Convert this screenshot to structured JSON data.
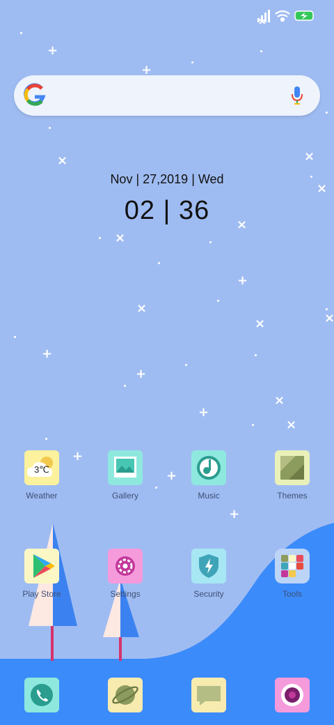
{
  "status_bar": {
    "icons": [
      "signal-icon",
      "wifi-icon",
      "battery-charging-icon"
    ]
  },
  "search": {
    "logo": "G",
    "icon": "microphone-icon"
  },
  "clock": {
    "date": "Nov | 27,2019 | Wed",
    "time": "02 | 36"
  },
  "apps": [
    {
      "label": "Weather",
      "icon": "weather-icon",
      "temp": "3℃"
    },
    {
      "label": "Gallery",
      "icon": "gallery-icon"
    },
    {
      "label": "Music",
      "icon": "music-icon"
    },
    {
      "label": "Themes",
      "icon": "themes-icon"
    },
    {
      "label": "Play Store",
      "icon": "play-store-icon"
    },
    {
      "label": "Settings",
      "icon": "settings-icon"
    },
    {
      "label": "Security",
      "icon": "security-icon"
    },
    {
      "label": "Tools",
      "icon": "tools-folder-icon"
    }
  ],
  "dock": [
    "phone-icon",
    "browser-icon",
    "messages-icon",
    "camera-icon"
  ],
  "colors": {
    "wallpaper": "#9fbcf2",
    "hill": "#3b8bfb",
    "label": "#3d4f74"
  }
}
